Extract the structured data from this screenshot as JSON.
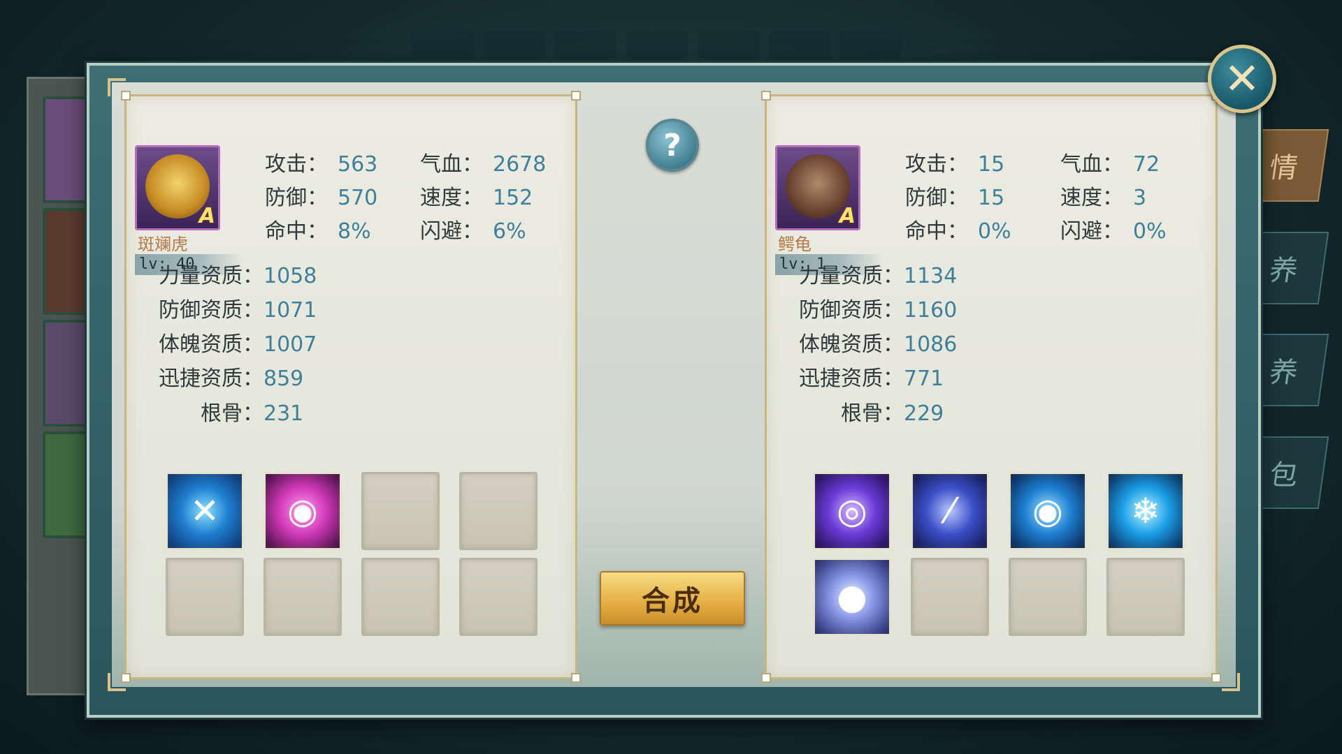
{
  "background": {
    "side_tabs": [
      "情",
      "养",
      "养",
      "包"
    ]
  },
  "left_pet": {
    "name": "斑斓虎",
    "level": "lv: 40",
    "grade": "A",
    "stats": [
      {
        "label": "攻击：",
        "value": "563"
      },
      {
        "label": "气血：",
        "value": "2678"
      },
      {
        "label": "防御：",
        "value": "570"
      },
      {
        "label": "速度：",
        "value": "152"
      },
      {
        "label": "命中：",
        "value": "8%"
      },
      {
        "label": "闪避：",
        "value": "6%"
      }
    ],
    "aptitudes": [
      {
        "label": "力量资质：",
        "value": "1058"
      },
      {
        "label": "防御资质：",
        "value": "1071"
      },
      {
        "label": "体魄资质：",
        "value": "1007"
      },
      {
        "label": "迅捷资质：",
        "value": "859"
      },
      {
        "label": "根骨：",
        "value": "231"
      }
    ],
    "skills": [
      {
        "icon": "crossed-chains-icon",
        "color": "#2a8fd8"
      },
      {
        "icon": "chain-jaw-icon",
        "color": "#d23ab8"
      },
      null,
      null,
      null,
      null,
      null,
      null
    ]
  },
  "right_pet": {
    "name": "鳄龟",
    "level": "lv: 1",
    "grade": "A",
    "stats": [
      {
        "label": "攻击：",
        "value": "15"
      },
      {
        "label": "气血：",
        "value": "72"
      },
      {
        "label": "防御：",
        "value": "15"
      },
      {
        "label": "速度：",
        "value": "3"
      },
      {
        "label": "命中：",
        "value": "0%"
      },
      {
        "label": "闪避：",
        "value": "0%"
      }
    ],
    "aptitudes": [
      {
        "label": "力量资质：",
        "value": "1134"
      },
      {
        "label": "防御资质：",
        "value": "1160"
      },
      {
        "label": "体魄资质：",
        "value": "1086"
      },
      {
        "label": "迅捷资质：",
        "value": "771"
      },
      {
        "label": "根骨：",
        "value": "229"
      }
    ],
    "skills": [
      {
        "icon": "purple-vortex-icon",
        "color": "#6a3bd6"
      },
      {
        "icon": "claw-slash-icon",
        "color": "#3c4fc8"
      },
      {
        "icon": "blue-chain-jaw-icon",
        "color": "#1e7fd0"
      },
      {
        "icon": "ice-wolf-icon",
        "color": "#1b9ee6"
      },
      {
        "icon": "spirit-orb-icon",
        "color": "#6c7fe0"
      },
      null,
      null,
      null
    ]
  },
  "buttons": {
    "help": "?",
    "merge": "合成",
    "close": "✕"
  }
}
